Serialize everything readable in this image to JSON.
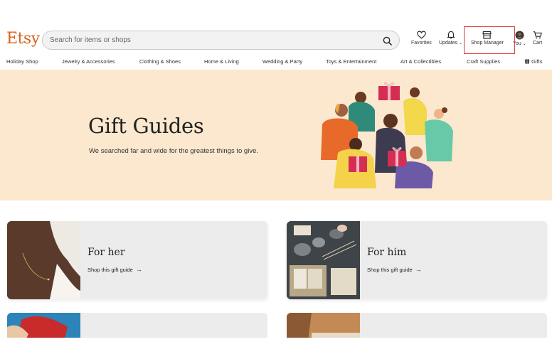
{
  "header": {
    "logo": "Etsy",
    "search_placeholder": "Search for items or shops",
    "favorites_label": "Favorites",
    "updates_label": "Updates",
    "shop_manager_label": "Shop Manager",
    "you_label": "You",
    "cart_label": "Cart"
  },
  "nav": {
    "items": [
      "Holiday Shop",
      "Jewelry & Accessories",
      "Clothing & Shoes",
      "Home & Living",
      "Wedding & Party",
      "Toys & Entertainment",
      "Art & Collectibles",
      "Craft Supplies",
      "Gifts"
    ]
  },
  "hero": {
    "title": "Gift Guides",
    "subtitle": "We searched far and wide for the greatest things to give."
  },
  "cards": [
    {
      "title": "For her",
      "link": "Shop this gift guide"
    },
    {
      "title": "For him",
      "link": "Shop this gift guide"
    }
  ],
  "colors": {
    "brand": "#d5641c",
    "hero_bg": "#fbe8ce",
    "highlight": "#e03a3a"
  }
}
